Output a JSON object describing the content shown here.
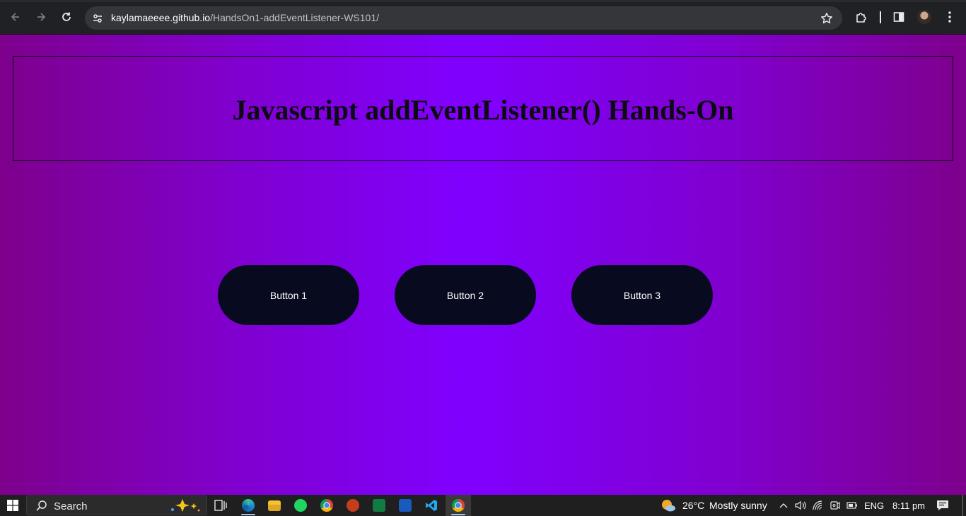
{
  "browser": {
    "url_host": "kaylamaeeee.github.io",
    "url_path": "/HandsOn1-addEventListener-WS101/",
    "icons": [
      "back-arrow-icon",
      "forward-arrow-icon",
      "reload-icon",
      "tune-icon",
      "bookmark-star-icon",
      "extensions-icon",
      "side-panel-icon",
      "profile-avatar",
      "kebab-menu-icon"
    ]
  },
  "page": {
    "title": "Javascript addEventListener() Hands-On",
    "buttons": [
      {
        "label": "Button 1"
      },
      {
        "label": "Button 2"
      },
      {
        "label": "Button 3"
      }
    ],
    "colors": {
      "gradient_edge": "#7e008c",
      "gradient_center": "#8000ff",
      "button_bg": "#080a1f",
      "button_text": "#ffffff",
      "title_text": "#0b0b12"
    }
  },
  "taskbar": {
    "search_label": "Search",
    "weather_temp": "26°C",
    "weather_desc": "Mostly sunny",
    "language": "ENG",
    "time": "8:11 pm",
    "apps": [
      "task-view",
      "edge",
      "file-explorer",
      "spotify",
      "chrome",
      "powerpoint",
      "excel",
      "word",
      "vscode",
      "chrome-active"
    ]
  }
}
